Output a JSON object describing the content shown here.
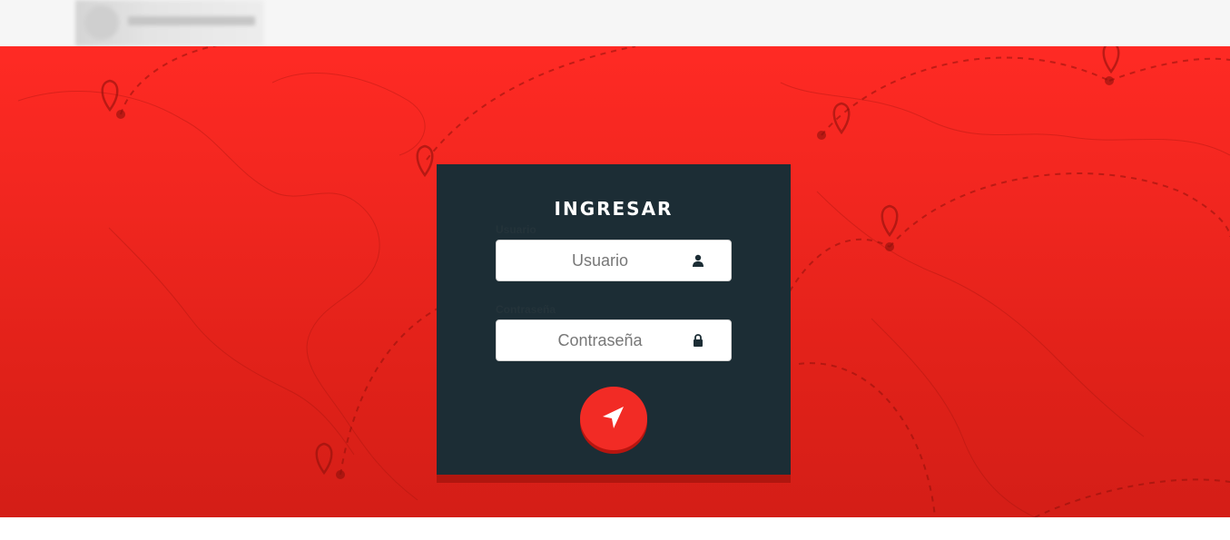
{
  "header": {
    "logo_alt": "logo"
  },
  "login": {
    "title": "INGRESAR",
    "username_label": "Usuario",
    "username_placeholder": "Usuario",
    "password_label": "Contraseña",
    "password_placeholder": "Contraseña",
    "submit_icon": "navigation-arrow-icon"
  },
  "colors": {
    "accent": "#f22b25",
    "card_bg": "#1c2d35",
    "header_bg": "#f6f6f6"
  }
}
